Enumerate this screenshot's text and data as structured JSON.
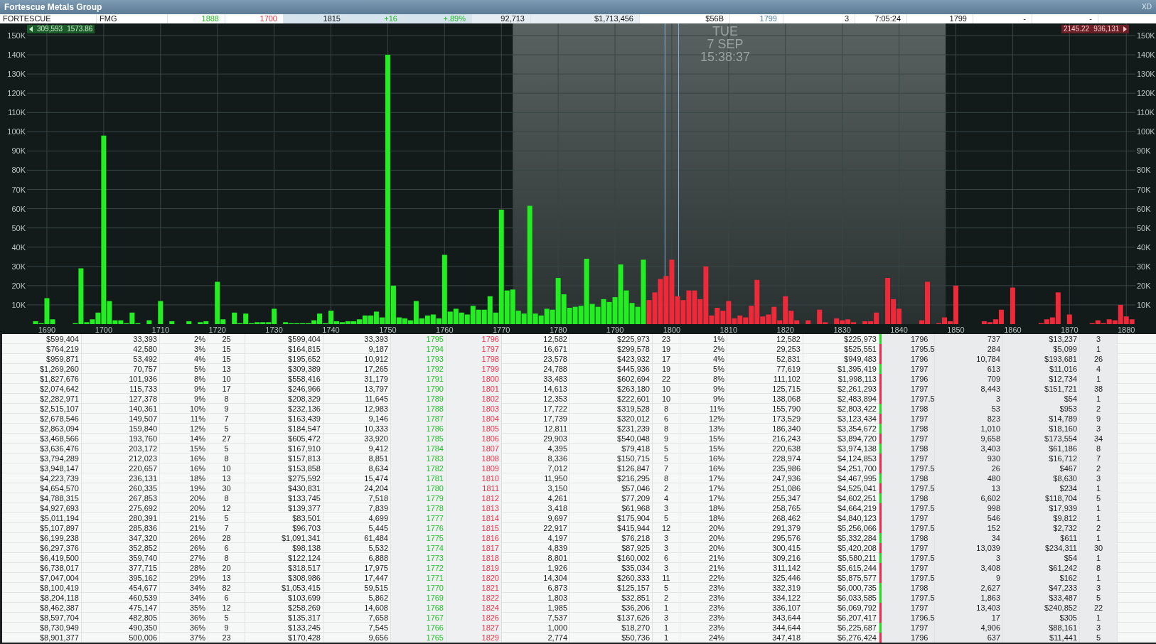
{
  "window": {
    "title": "Fortescue Metals Group",
    "badge": "XD"
  },
  "quote": [
    {
      "text": "FORTESCUE"
    },
    {
      "text": "FMG"
    },
    {
      "text": "1888",
      "color": "#22bb22"
    },
    {
      "text": "1700",
      "color": "#dd3344"
    },
    {
      "text": "1815"
    },
    {
      "text": "+16",
      "color": "#22bb22"
    },
    {
      "text": "+.89%",
      "color": "#22bb22"
    },
    {
      "text": "92,713"
    },
    {
      "text": "$1,713,456"
    },
    {
      "text": "$56B"
    },
    {
      "text": "1799",
      "color": "#4a7fa8"
    },
    {
      "text": "3"
    },
    {
      "text": "7:05:24"
    },
    {
      "text": "1799"
    },
    {
      "text": "-"
    },
    {
      "text": "-"
    }
  ],
  "chart": {
    "left_marker": [
      "309,593",
      "1573.86"
    ],
    "right_marker": [
      "2145.22",
      "936,131"
    ],
    "overlay_date": [
      "TUE",
      "7 SEP",
      "15:38:37"
    ],
    "chart_data": {
      "type": "bar",
      "grid": true,
      "xlim": [
        1686.5,
        1881.6
      ],
      "ylim": [
        0,
        150000
      ],
      "bands": [
        {
          "axis": "x",
          "from": 1772,
          "to": 1848.2
        }
      ],
      "ref_lines": [
        {
          "axis": "x",
          "value": 1798.8
        },
        {
          "axis": "x",
          "value": 1801.2
        }
      ],
      "xticks": [
        1690,
        1700,
        1710,
        1720,
        1730,
        1740,
        1750,
        1760,
        1770,
        1780,
        1790,
        1800,
        1810,
        1820,
        1830,
        1840,
        1850,
        1860,
        1870,
        1880
      ],
      "yticks": [
        {
          "value": 10000,
          "label": "10K"
        },
        {
          "value": 20000,
          "label": "20K"
        },
        {
          "value": 30000,
          "label": "30K"
        },
        {
          "value": 40000,
          "label": "40K"
        },
        {
          "value": 50000,
          "label": "50K"
        },
        {
          "value": 60000,
          "label": "60K"
        },
        {
          "value": 70000,
          "label": "70K"
        },
        {
          "value": 80000,
          "label": "80K"
        },
        {
          "value": 90000,
          "label": "90K"
        },
        {
          "value": 100000,
          "label": "100K"
        },
        {
          "value": 110000,
          "label": "110K"
        },
        {
          "value": 120000,
          "label": "120K"
        },
        {
          "value": 130000,
          "label": "130K"
        },
        {
          "value": 140000,
          "label": "140K"
        },
        {
          "value": 150000,
          "label": "150K"
        }
      ],
      "x": [
        1688,
        1689,
        1690,
        1691,
        1695,
        1696,
        1697,
        1698,
        1699,
        1700,
        1701,
        1702,
        1703,
        1704,
        1705,
        1706,
        1708,
        1710,
        1712,
        1715,
        1717,
        1718,
        1720,
        1721,
        1723,
        1724,
        1725,
        1726,
        1727,
        1728,
        1729,
        1730,
        1732,
        1733,
        1734,
        1735,
        1736,
        1737,
        1738,
        1739,
        1740,
        1741,
        1742,
        1743,
        1744,
        1745,
        1746,
        1747,
        1748,
        1749,
        1750,
        1751,
        1752,
        1753,
        1754,
        1755,
        1756,
        1757,
        1758,
        1759,
        1760,
        1761,
        1762,
        1763,
        1764,
        1765,
        1766,
        1767,
        1768,
        1769,
        1770,
        1771,
        1772,
        1773,
        1774,
        1775,
        1776,
        1777,
        1778,
        1779,
        1780,
        1781,
        1782,
        1783,
        1784,
        1785,
        1786,
        1787,
        1788,
        1789,
        1790,
        1791,
        1792,
        1793,
        1794,
        1795,
        1796,
        1797,
        1798,
        1799,
        1800,
        1801,
        1802,
        1803,
        1804,
        1805,
        1806,
        1807,
        1808,
        1809,
        1810,
        1811,
        1812,
        1813,
        1814,
        1815,
        1816,
        1817,
        1818,
        1819,
        1820,
        1821,
        1822,
        1824,
        1826,
        1827,
        1829,
        1830,
        1831,
        1832,
        1834,
        1835,
        1836,
        1838,
        1839,
        1840,
        1844,
        1845,
        1847,
        1848,
        1849,
        1850,
        1855,
        1856,
        1857,
        1858,
        1860,
        1865,
        1866,
        1867,
        1868,
        1870,
        1874,
        1875,
        1876,
        1877,
        1878,
        1879,
        1880,
        1881
      ],
      "series": [
        {
          "color": "#22ee22",
          "values": [
            1500,
            500,
            13500,
            2500,
            500,
            29000,
            1000,
            2500,
            6000,
            98000,
            12000,
            2000,
            2000,
            500,
            6000,
            500,
            2000,
            12000,
            1500,
            1500,
            1000,
            1500,
            22000,
            2500,
            6000,
            500,
            5500,
            500,
            1000,
            1000,
            1000,
            8000,
            1000,
            500,
            500,
            500,
            500,
            2000,
            5500,
            500,
            7000,
            1500,
            1000,
            1500,
            1500,
            2500,
            4500,
            4500,
            6500,
            3500,
            140000,
            20000,
            3500,
            3000,
            2000,
            12000,
            3000,
            4500,
            5000,
            3000,
            36000,
            6500,
            8000,
            6000,
            5000,
            9500,
            7500,
            7500,
            14500,
            6000,
            59500,
            17500,
            18000,
            7000,
            5500,
            61500,
            5500,
            4500,
            8000,
            7500,
            24000,
            15500,
            8500,
            9000,
            9500,
            34000,
            10500,
            9000,
            13000,
            11500,
            14000,
            31000,
            17500,
            11000,
            9000,
            33500,
            null,
            null,
            null,
            null,
            null,
            null,
            null,
            null,
            null,
            null,
            null,
            null,
            null,
            null,
            null,
            null,
            null,
            null,
            null,
            null,
            null,
            null,
            null,
            null,
            null,
            null,
            null,
            null,
            null,
            null,
            null,
            null,
            null,
            null,
            null,
            null,
            null,
            null,
            null,
            null,
            null,
            null,
            null,
            null,
            null,
            null,
            null,
            null,
            null,
            null,
            null,
            null,
            null,
            null,
            null,
            null,
            null,
            null,
            null,
            null,
            null,
            null,
            null,
            null
          ]
        },
        {
          "color": "#ee2a3a",
          "values": [
            null,
            null,
            null,
            null,
            null,
            null,
            null,
            null,
            null,
            null,
            null,
            null,
            null,
            null,
            null,
            null,
            null,
            null,
            null,
            null,
            null,
            null,
            null,
            null,
            null,
            null,
            null,
            null,
            null,
            null,
            null,
            null,
            null,
            null,
            null,
            null,
            null,
            null,
            null,
            null,
            null,
            null,
            null,
            null,
            null,
            null,
            null,
            null,
            null,
            null,
            null,
            null,
            null,
            null,
            null,
            null,
            null,
            null,
            null,
            null,
            null,
            null,
            null,
            null,
            null,
            null,
            null,
            null,
            null,
            null,
            null,
            null,
            null,
            null,
            null,
            null,
            null,
            null,
            null,
            null,
            null,
            null,
            null,
            null,
            null,
            null,
            null,
            null,
            null,
            null,
            null,
            null,
            null,
            null,
            null,
            null,
            12500,
            16500,
            23500,
            25000,
            33500,
            14500,
            12500,
            17500,
            17500,
            13000,
            30000,
            4500,
            8500,
            7000,
            12000,
            3000,
            4500,
            3500,
            9500,
            23000,
            4000,
            5000,
            9000,
            2000,
            14500,
            7000,
            2000,
            2000,
            7500,
            1000,
            3000,
            2000,
            2500,
            1000,
            1500,
            1500,
            6000,
            24000,
            13000,
            8000,
            2000,
            22000,
            500,
            3500,
            1500,
            20000,
            1500,
            1000,
            2500,
            7500,
            19000,
            500,
            2500,
            3500,
            16500,
            5000,
            500,
            2000,
            500,
            2500,
            2000,
            10000,
            4000,
            2500
          ]
        }
      ]
    }
  },
  "table": {
    "rows": [
      {
        "color": "#22dd22",
        "cells": [
          "$599,404",
          "33,393",
          "2%",
          "25",
          "$599,404",
          "33,393",
          "1795",
          "1796",
          "12,582",
          "$225,973",
          "23",
          "1%",
          "12,582",
          "$225,973",
          "1796",
          "737",
          "$13,237",
          "3"
        ]
      },
      {
        "color": "#ee2a50",
        "cells": [
          "$764,219",
          "42,580",
          "3%",
          "15",
          "$164,815",
          "9,187",
          "1794",
          "1797",
          "16,671",
          "$299,578",
          "19",
          "2%",
          "29,253",
          "$525,551",
          "1795.5",
          "284",
          "$5,099",
          "1"
        ]
      },
      {
        "color": "#ee2a50",
        "cells": [
          "$959,871",
          "53,492",
          "4%",
          "15",
          "$195,652",
          "10,912",
          "1793",
          "1798",
          "23,578",
          "$423,932",
          "17",
          "4%",
          "52,831",
          "$949,483",
          "1796",
          "10,784",
          "$193,681",
          "26"
        ]
      },
      {
        "color": "#22dd22",
        "cells": [
          "$1,269,260",
          "70,757",
          "5%",
          "13",
          "$309,389",
          "17,265",
          "1792",
          "1799",
          "24,788",
          "$445,936",
          "19",
          "5%",
          "77,619",
          "$1,395,419",
          "1797",
          "613",
          "$11,016",
          "4"
        ]
      },
      {
        "color": "#ee2a50",
        "cells": [
          "$1,827,676",
          "101,936",
          "8%",
          "10",
          "$558,416",
          "31,179",
          "1791",
          "1800",
          "33,483",
          "$602,694",
          "22",
          "8%",
          "111,102",
          "$1,998,113",
          "1796",
          "709",
          "$12,734",
          "1"
        ]
      },
      {
        "color": "#ee2a50",
        "cells": [
          "$2,074,642",
          "115,733",
          "9%",
          "17",
          "$246,966",
          "13,797",
          "1790",
          "1801",
          "14,613",
          "$263,180",
          "10",
          "9%",
          "125,715",
          "$2,261,293",
          "1797",
          "8,443",
          "$151,721",
          "38"
        ]
      },
      {
        "color": "#ee2a50",
        "cells": [
          "$2,282,971",
          "127,378",
          "9%",
          "8",
          "$208,329",
          "11,645",
          "1789",
          "1802",
          "12,353",
          "$222,601",
          "10",
          "9%",
          "138,068",
          "$2,483,894",
          "1797.5",
          "3",
          "$54",
          "1"
        ]
      },
      {
        "color": "#22dd22",
        "cells": [
          "$2,515,107",
          "140,361",
          "10%",
          "9",
          "$232,136",
          "12,983",
          "1788",
          "1803",
          "17,722",
          "$319,528",
          "8",
          "11%",
          "155,790",
          "$2,803,422",
          "1798",
          "53",
          "$953",
          "2"
        ]
      },
      {
        "color": "#ee2a50",
        "cells": [
          "$2,678,546",
          "149,507",
          "11%",
          "7",
          "$163,439",
          "9,146",
          "1787",
          "1804",
          "17,739",
          "$320,012",
          "6",
          "12%",
          "173,529",
          "$3,123,434",
          "1797",
          "823",
          "$14,789",
          "9"
        ]
      },
      {
        "color": "#22dd22",
        "cells": [
          "$2,863,094",
          "159,840",
          "12%",
          "5",
          "$184,547",
          "10,333",
          "1786",
          "1805",
          "12,811",
          "$231,239",
          "8",
          "13%",
          "186,340",
          "$3,354,672",
          "1798",
          "1,010",
          "$18,160",
          "3"
        ]
      },
      {
        "color": "#ee2a50",
        "cells": [
          "$3,468,566",
          "193,760",
          "14%",
          "27",
          "$605,472",
          "33,920",
          "1785",
          "1806",
          "29,903",
          "$540,048",
          "9",
          "15%",
          "216,243",
          "$3,894,720",
          "1797",
          "9,658",
          "$173,554",
          "34"
        ]
      },
      {
        "color": "#22dd22",
        "cells": [
          "$3,636,476",
          "203,172",
          "15%",
          "5",
          "$167,910",
          "9,412",
          "1784",
          "1807",
          "4,395",
          "$79,418",
          "5",
          "15%",
          "220,638",
          "$3,974,138",
          "1798",
          "3,403",
          "$61,186",
          "8"
        ]
      },
      {
        "color": "#ee2a50",
        "cells": [
          "$3,794,289",
          "212,023",
          "16%",
          "8",
          "$157,813",
          "8,851",
          "1783",
          "1808",
          "8,336",
          "$150,715",
          "5",
          "16%",
          "228,974",
          "$4,124,853",
          "1797",
          "930",
          "$16,712",
          "7"
        ]
      },
      {
        "color": "#ee2a50",
        "cells": [
          "$3,948,147",
          "220,657",
          "16%",
          "10",
          "$153,858",
          "8,634",
          "1782",
          "1809",
          "7,012",
          "$126,847",
          "7",
          "16%",
          "235,986",
          "$4,251,700",
          "1797.5",
          "26",
          "$467",
          "2"
        ]
      },
      {
        "color": "#22dd22",
        "cells": [
          "$4,223,739",
          "236,131",
          "18%",
          "13",
          "$275,592",
          "15,474",
          "1781",
          "1810",
          "11,950",
          "$216,295",
          "8",
          "17%",
          "247,936",
          "$4,467,995",
          "1798",
          "480",
          "$8,630",
          "3"
        ]
      },
      {
        "color": "#ee2a50",
        "cells": [
          "$4,654,570",
          "260,335",
          "19%",
          "30",
          "$430,831",
          "24,204",
          "1780",
          "1811",
          "3,150",
          "$57,046",
          "2",
          "17%",
          "251,086",
          "$4,525,041",
          "1797.5",
          "13",
          "$234",
          "1"
        ]
      },
      {
        "color": "#22dd22",
        "cells": [
          "$4,788,315",
          "267,853",
          "20%",
          "8",
          "$133,745",
          "7,518",
          "1779",
          "1812",
          "4,261",
          "$77,209",
          "4",
          "17%",
          "255,347",
          "$4,602,251",
          "1798",
          "6,602",
          "$118,704",
          "5"
        ]
      },
      {
        "color": "#ee2a50",
        "cells": [
          "$4,927,693",
          "275,692",
          "20%",
          "12",
          "$139,377",
          "7,839",
          "1778",
          "1813",
          "3,418",
          "$61,968",
          "3",
          "18%",
          "258,765",
          "$4,664,219",
          "1797.5",
          "998",
          "$17,939",
          "1"
        ]
      },
      {
        "color": "#ee2a50",
        "cells": [
          "$5,011,194",
          "280,391",
          "21%",
          "5",
          "$83,501",
          "4,699",
          "1777",
          "1814",
          "9,697",
          "$175,904",
          "5",
          "18%",
          "268,462",
          "$4,840,123",
          "1797",
          "546",
          "$9,812",
          "1"
        ]
      },
      {
        "color": "#ee2a50",
        "cells": [
          "$5,107,897",
          "285,836",
          "21%",
          "7",
          "$96,703",
          "5,445",
          "1776",
          "1815",
          "22,917",
          "$415,944",
          "12",
          "20%",
          "291,379",
          "$5,256,066",
          "1797.5",
          "152",
          "$2,732",
          "2"
        ]
      },
      {
        "color": "#22dd22",
        "cells": [
          "$6,199,238",
          "347,320",
          "26%",
          "28",
          "$1,091,341",
          "61,484",
          "1775",
          "1816",
          "4,197",
          "$76,218",
          "3",
          "20%",
          "295,576",
          "$5,332,284",
          "1798",
          "34",
          "$611",
          "1"
        ]
      },
      {
        "color": "#ee2a50",
        "cells": [
          "$6,297,376",
          "352,852",
          "26%",
          "6",
          "$98,138",
          "5,532",
          "1774",
          "1817",
          "4,839",
          "$87,925",
          "3",
          "20%",
          "300,415",
          "$5,420,208",
          "1797",
          "13,039",
          "$234,311",
          "30"
        ]
      },
      {
        "color": "#22dd22",
        "cells": [
          "$6,419,500",
          "359,740",
          "27%",
          "8",
          "$122,124",
          "6,888",
          "1773",
          "1818",
          "8,801",
          "$160,002",
          "6",
          "21%",
          "309,216",
          "$5,580,211",
          "1797.5",
          "3",
          "$54",
          "1"
        ]
      },
      {
        "color": "#ee2a50",
        "cells": [
          "$6,738,017",
          "377,715",
          "28%",
          "20",
          "$318,517",
          "17,975",
          "1772",
          "1819",
          "1,926",
          "$35,034",
          "3",
          "21%",
          "311,142",
          "$5,615,244",
          "1797",
          "3,408",
          "$61,242",
          "8"
        ]
      },
      {
        "color": "#ee2a50",
        "cells": [
          "$7,047,004",
          "395,162",
          "29%",
          "13",
          "$308,986",
          "17,447",
          "1771",
          "1820",
          "14,304",
          "$260,333",
          "11",
          "22%",
          "325,446",
          "$5,875,577",
          "1797.5",
          "9",
          "$162",
          "1"
        ]
      },
      {
        "color": "#22dd22",
        "cells": [
          "$8,100,419",
          "454,677",
          "34%",
          "82",
          "$1,053,415",
          "59,515",
          "1770",
          "1821",
          "6,873",
          "$125,157",
          "5",
          "23%",
          "332,319",
          "$6,000,735",
          "1798",
          "2,627",
          "$47,233",
          "3"
        ]
      },
      {
        "color": "#22dd22",
        "cells": [
          "$8,204,118",
          "460,539",
          "34%",
          "6",
          "$103,699",
          "5,862",
          "1769",
          "1822",
          "1,803",
          "$32,851",
          "2",
          "23%",
          "334,122",
          "$6,033,585",
          "1797.5",
          "1,863",
          "$33,487",
          "5"
        ]
      },
      {
        "color": "#ee2a50",
        "cells": [
          "$8,462,387",
          "475,147",
          "35%",
          "12",
          "$258,269",
          "14,608",
          "1768",
          "1824",
          "1,985",
          "$36,206",
          "1",
          "23%",
          "336,107",
          "$6,069,792",
          "1797",
          "13,403",
          "$240,852",
          "22"
        ]
      },
      {
        "color": "#ee2a50",
        "cells": [
          "$8,597,704",
          "482,805",
          "36%",
          "5",
          "$135,317",
          "7,658",
          "1767",
          "1826",
          "7,537",
          "$137,626",
          "3",
          "23%",
          "343,644",
          "$6,207,417",
          "1796.5",
          "17",
          "$305",
          "1"
        ]
      },
      {
        "color": "#22dd22",
        "cells": [
          "$8,730,949",
          "490,350",
          "36%",
          "9",
          "$133,245",
          "7,545",
          "1766",
          "1827",
          "1,000",
          "$18,270",
          "1",
          "23%",
          "344,644",
          "$6,225,687",
          "1797",
          "4,906",
          "$88,161",
          "3"
        ]
      },
      {
        "color": "#ee2a50",
        "cells": [
          "$8,901,377",
          "500,006",
          "37%",
          "23",
          "$170,428",
          "9,656",
          "1765",
          "1829",
          "2,774",
          "$50,736",
          "1",
          "24%",
          "347,418",
          "$6,276,424",
          "1796",
          "637",
          "$11,441",
          "5"
        ]
      }
    ]
  }
}
